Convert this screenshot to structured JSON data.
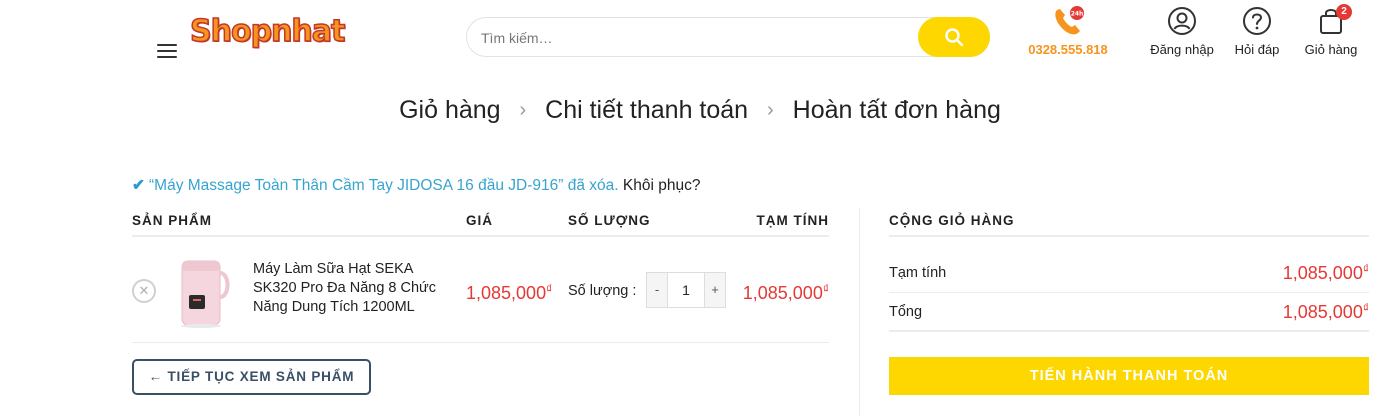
{
  "header": {
    "logo_text": "Shopnhat",
    "search": {
      "placeholder": "Tìm kiếm…"
    },
    "phone": {
      "number": "0328.555.818",
      "badge": "24h"
    },
    "login_label": "Đăng nhập",
    "help_label": "Hỏi đáp",
    "cart": {
      "label": "Giỏ hàng",
      "count": "2"
    }
  },
  "steps": [
    "Giỏ hàng",
    "Chi tiết thanh toán",
    "Hoàn tất đơn hàng"
  ],
  "notice": {
    "message": "“Máy Massage Toàn Thân Cầm Tay JIDOSA 16 đầu JD-916” đã xóa.",
    "undo_label": "Khôi phục?"
  },
  "cart_table": {
    "headers": {
      "product": "SẢN PHẨM",
      "price": "GIÁ",
      "quantity": "SỐ LƯỢNG",
      "subtotal": "TẠM TÍNH"
    },
    "items": [
      {
        "name": "Máy Làm Sữa Hạt SEKA SK320 Pro Đa Năng 8 Chức Năng Dung Tích 1200ML",
        "price": "1,085,000",
        "qty_label": "Số lượng :",
        "quantity": "1",
        "subtotal": "1,085,000"
      }
    ],
    "currency_symbol": "₫",
    "continue_label": "← TIẾP TỤC XEM SẢN PHẨM"
  },
  "totals": {
    "heading": "CỘNG GIỎ HÀNG",
    "subtotal_label": "Tạm tính",
    "subtotal_value": "1,085,000",
    "total_label": "Tổng",
    "total_value": "1,085,000",
    "checkout_label": "TIẾN HÀNH THANH TOÁN"
  },
  "colors": {
    "accent_yellow": "#fed700",
    "price_red": "#e53935",
    "notice_blue": "#37a4cf",
    "logo_orange": "#f7941d",
    "button_navy": "#3a4f66"
  },
  "icons": [
    "menu-icon",
    "search-icon",
    "phone-icon",
    "user-icon",
    "help-icon",
    "cart-icon",
    "check-icon",
    "remove-icon"
  ]
}
